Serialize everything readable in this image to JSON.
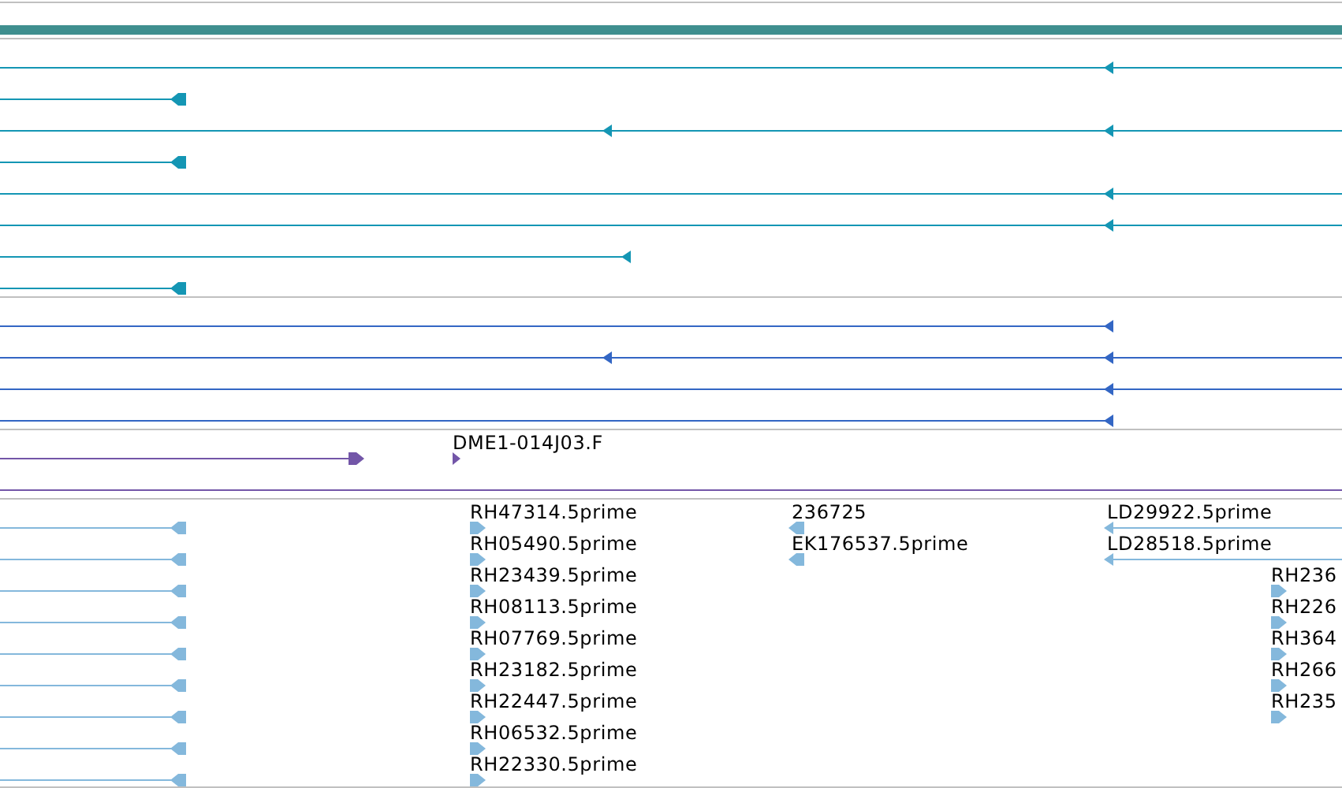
{
  "tracks": [
    {
      "kind": "band",
      "color": "#3f8f8f"
    },
    {
      "kind": "features",
      "color": "#1496b4",
      "rows": [
        {
          "features": [
            {
              "reverse": true
            }
          ]
        },
        {
          "features": [
            {
              "reverse": true
            }
          ]
        },
        {
          "features": [
            {
              "reverse": true
            }
          ]
        },
        {
          "features": [
            {
              "reverse": true
            }
          ]
        },
        {
          "features": [
            {
              "reverse": true
            }
          ]
        },
        {
          "features": [
            {
              "reverse": true
            }
          ]
        },
        {
          "features": [
            {
              "reverse": true
            }
          ]
        },
        {
          "features": [
            {
              "reverse": true
            }
          ]
        }
      ]
    },
    {
      "kind": "features",
      "color": "#3366c4",
      "rows": [
        {
          "features": [
            {
              "reverse": true
            }
          ]
        },
        {
          "features": [
            {
              "reverse": true
            }
          ]
        },
        {
          "features": [
            {
              "reverse": true
            }
          ]
        },
        {
          "features": [
            {
              "reverse": true
            }
          ]
        }
      ]
    },
    {
      "kind": "features",
      "color": "#7356a8",
      "rows": [
        {
          "features": [
            {
              "reverse": false
            },
            {
              "reverse": false,
              "label": "DME1-014J03.F"
            }
          ]
        }
      ]
    },
    {
      "kind": "features",
      "color": "#84b8dc",
      "rows": [
        {
          "features": [
            {
              "reverse": true
            },
            {
              "reverse": false,
              "label": "RH47314.5prime"
            },
            {
              "reverse": true,
              "label": "236725"
            },
            {
              "reverse": true,
              "label": "LD29922.5prime"
            }
          ]
        },
        {
          "features": [
            {
              "reverse": true
            },
            {
              "reverse": false,
              "label": "RH05490.5prime"
            },
            {
              "reverse": true,
              "label": "EK176537.5prime"
            },
            {
              "reverse": true,
              "label": "LD28518.5prime"
            }
          ]
        },
        {
          "features": [
            {
              "reverse": true
            },
            {
              "reverse": false,
              "label": "RH23439.5prime"
            },
            {
              "reverse": false,
              "label": "RH236"
            }
          ]
        },
        {
          "features": [
            {
              "reverse": true
            },
            {
              "reverse": false,
              "label": "RH08113.5prime"
            },
            {
              "reverse": false,
              "label": "RH226"
            }
          ]
        },
        {
          "features": [
            {
              "reverse": true
            },
            {
              "reverse": false,
              "label": "RH07769.5prime"
            },
            {
              "reverse": false,
              "label": "RH364"
            }
          ]
        },
        {
          "features": [
            {
              "reverse": true
            },
            {
              "reverse": false,
              "label": "RH23182.5prime"
            },
            {
              "reverse": false,
              "label": "RH266"
            }
          ]
        },
        {
          "features": [
            {
              "reverse": true
            },
            {
              "reverse": false,
              "label": "RH22447.5prime"
            },
            {
              "reverse": false,
              "label": "RH235"
            }
          ]
        },
        {
          "features": [
            {
              "reverse": true
            },
            {
              "reverse": false,
              "label": "RH06532.5prime"
            }
          ]
        },
        {
          "features": [
            {
              "reverse": true
            },
            {
              "reverse": false,
              "label": "RH22330.5prime"
            }
          ]
        }
      ]
    }
  ]
}
